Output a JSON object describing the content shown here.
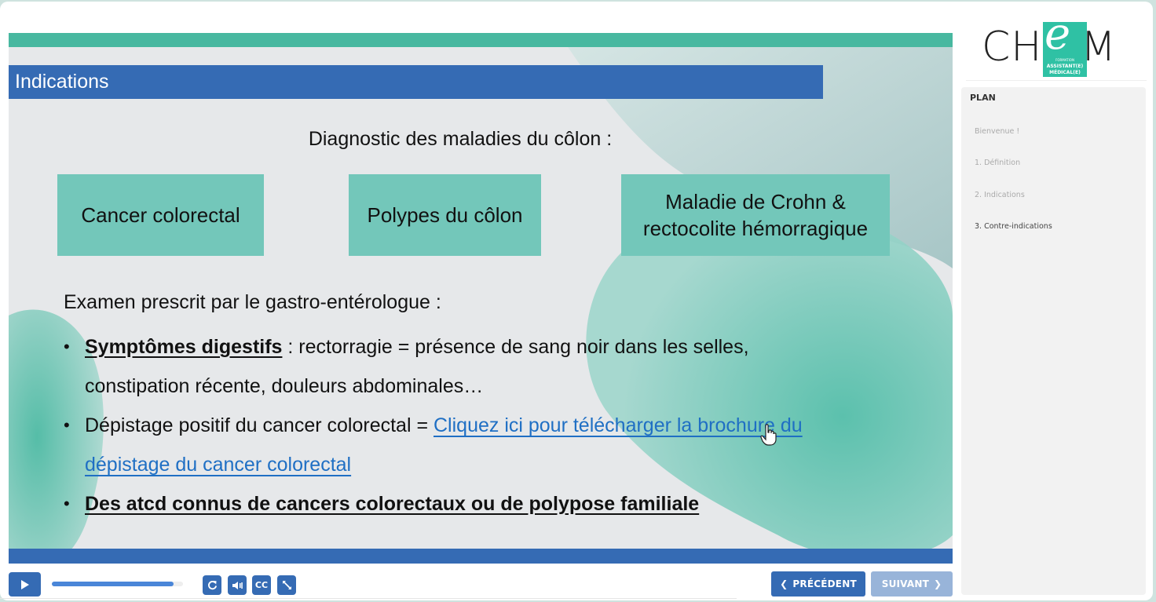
{
  "slide": {
    "title": "Indications",
    "subtitle": "Diagnostic des maladies du côlon :",
    "boxes": [
      {
        "label": "Cancer colorectal"
      },
      {
        "label": "Polypes du côlon"
      },
      {
        "line1": "Maladie de Crohn &",
        "line2": "rectocolite hémorragique"
      }
    ],
    "intro": "Examen prescrit par le gastro-entérologue :",
    "bullets": {
      "b1_strong": "Symptômes digestifs",
      "b1_rest": " : rectorragie = présence de sang noir dans les selles,",
      "b1_cont": "constipation récente, douleurs abdominales…",
      "b2_text": "Dépistage positif du cancer colorectal = ",
      "b2_link_line1": "Cliquez ici pour télécharger la brochure du",
      "b2_link_line2": "dépistage du cancer colorectal",
      "b3_strong": "Des atcd connus de cancers colorectaux ou de polypose familiale"
    },
    "colors": {
      "accent_teal": "#48b8a0",
      "accent_blue": "#356bb4",
      "box_fill": "#73c7ba",
      "link": "#1f6fc4"
    }
  },
  "controls": {
    "play_icon": "play-icon",
    "progress_fraction": 0.93,
    "replay_icon": "replay-icon",
    "volume_icon": "volume-icon",
    "cc_label": "CC",
    "fullscreen_icon": "fullscreen-icon",
    "prev_label": "PRÉCÉDENT",
    "next_label": "SUIVANT"
  },
  "sidebar": {
    "logo": {
      "left": "CH",
      "e": "e",
      "right": "M",
      "sub1": "FORMATION",
      "sub2": "ASSISTANT(E)",
      "sub3": "MÉDICAL(E)"
    },
    "plan_title": "PLAN",
    "plan_items": [
      {
        "label": "Bienvenue !",
        "active": false
      },
      {
        "label": "1. Définition",
        "active": false
      },
      {
        "label": "2. Indications",
        "active": false
      },
      {
        "label": "3. Contre-indications",
        "active": true
      }
    ]
  }
}
